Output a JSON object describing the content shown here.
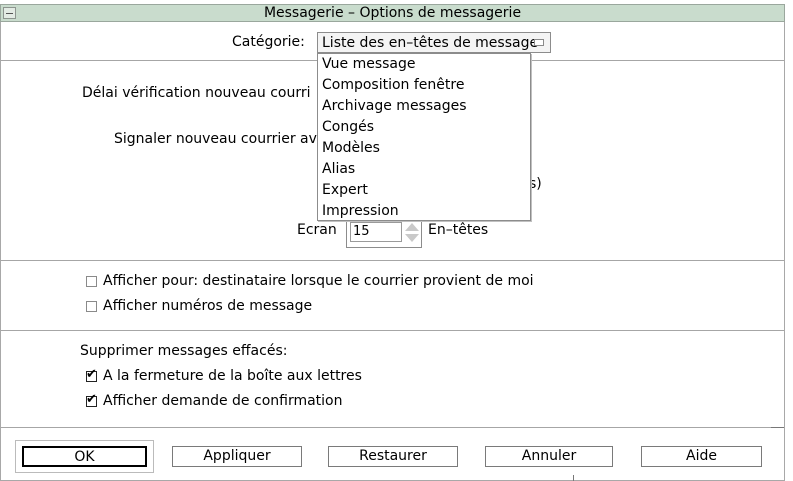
{
  "window": {
    "title": "Messagerie – Options de messagerie"
  },
  "category": {
    "label": "Catégorie:",
    "selected": "Liste des en–têtes de message",
    "options": [
      "Vue message",
      "Composition fenêtre",
      "Archivage messages",
      "Congés",
      "Modèles",
      "Alias",
      "Expert",
      "Impression"
    ]
  },
  "headers_section": {
    "check_delay_label": "Délai vérification nouveau courri",
    "signal_label": "Signaler nouveau courrier av",
    "paren_fragment": "s)",
    "screen_label": "Ecran",
    "screen_value": "15",
    "screen_unit": "En–têtes"
  },
  "display_section": {
    "show_to_label": "Afficher pour: destinataire lorsque le courrier provient de moi",
    "show_to_checked": false,
    "show_numbers_label": "Afficher numéros de message",
    "show_numbers_checked": false
  },
  "delete_section": {
    "heading": "Supprimer messages effacés:",
    "on_close_label": "A la fermeture de la boîte aux lettres",
    "on_close_checked": true,
    "confirm_label": "Afficher demande de confirmation",
    "confirm_checked": true
  },
  "buttons": {
    "ok": "OK",
    "apply": "Appliquer",
    "restore": "Restaurer",
    "cancel": "Annuler",
    "help": "Aide"
  }
}
